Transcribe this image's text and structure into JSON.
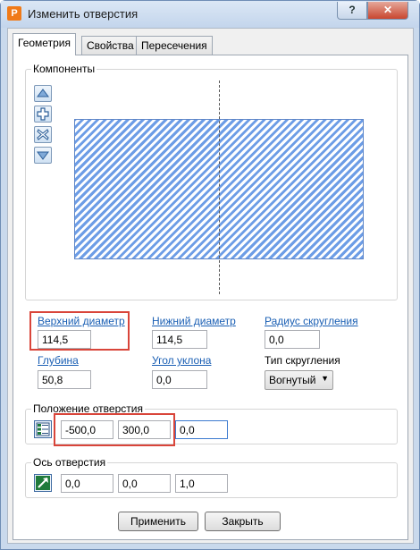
{
  "window": {
    "title": "Изменить отверстия",
    "app_icon_letter": "P",
    "help_label": "?",
    "close_label": "✕"
  },
  "tabs": [
    {
      "label": "Геометрия",
      "active": true
    },
    {
      "label": "Свойства",
      "active": false
    },
    {
      "label": "Пересечения",
      "active": false
    }
  ],
  "components": {
    "label": "Компоненты",
    "buttons": [
      "move-up-icon",
      "add-icon",
      "remove-icon",
      "move-down-icon"
    ]
  },
  "fields": {
    "top_diameter": {
      "label": "Верхний диаметр",
      "value": "114,5"
    },
    "bottom_diameter": {
      "label": "Нижний диаметр",
      "value": "114,5"
    },
    "fillet_radius": {
      "label": "Радиус скругления",
      "value": "0,0"
    },
    "depth": {
      "label": "Глубина",
      "value": "50,8"
    },
    "draft_angle": {
      "label": "Угол уклона",
      "value": "0,0"
    },
    "fillet_type": {
      "label": "Тип скругления",
      "value": "Вогнутый"
    }
  },
  "position": {
    "label": "Положение отверстия",
    "x": "-500,0",
    "y": "300,0",
    "z": "0,0"
  },
  "axis": {
    "label": "Ось отверстия",
    "x": "0,0",
    "y": "0,0",
    "z": "1,0"
  },
  "buttons": {
    "apply": "Применить",
    "close": "Закрыть"
  },
  "colors": {
    "hatch": "#6d9de6",
    "highlight": "#d9453a",
    "link": "#1a5fb4"
  }
}
